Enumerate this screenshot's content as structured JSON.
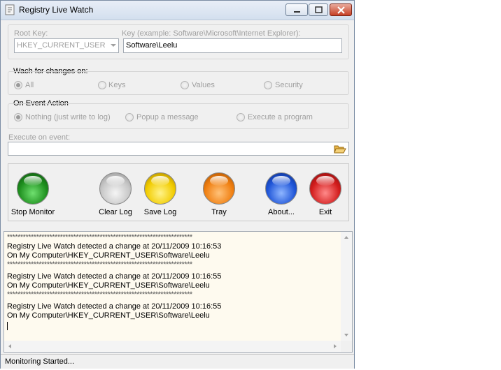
{
  "window": {
    "title": "Registry Live Watch"
  },
  "key_panel": {
    "root_key_label": "Root Key:",
    "root_key_value": "HKEY_CURRENT_USER",
    "key_label": "Key (example: Software\\Microsoft\\Internet Explorer):",
    "key_value": "Software\\Leelu"
  },
  "watch": {
    "legend": "Wach for changes on:",
    "options": [
      "All",
      "Keys",
      "Values",
      "Security"
    ],
    "selected": "All"
  },
  "action": {
    "legend": "On Event Action",
    "options": [
      "Nothing (just write to log)",
      "Popup a message",
      "Execute a program"
    ],
    "selected": "Nothing (just write to log)"
  },
  "execute": {
    "label": "Execute on event:",
    "value": ""
  },
  "buttons": {
    "stop": "Stop Monitor",
    "clear": "Clear Log",
    "save": "Save Log",
    "tray": "Tray",
    "about": "About...",
    "exit": "Exit"
  },
  "colors": {
    "stop": "#1e8f1e",
    "clear": "#c8c8c8",
    "save": "#f2cc00",
    "tray": "#f07f10",
    "about": "#1f55d8",
    "exit": "#d31d1d"
  },
  "log": {
    "lines": [
      "**********************************************************************",
      "Registry Live Watch detected a change at 20/11/2009 10:16:53",
      "On My Computer\\HKEY_CURRENT_USER\\Software\\Leelu",
      "**********************************************************************",
      "Registry Live Watch detected a change at 20/11/2009 10:16:55",
      "On My Computer\\HKEY_CURRENT_USER\\Software\\Leelu",
      "**********************************************************************",
      "Registry Live Watch detected a change at 20/11/2009 10:16:55",
      "On My Computer\\HKEY_CURRENT_USER\\Software\\Leelu"
    ]
  },
  "status": "Monitoring Started..."
}
